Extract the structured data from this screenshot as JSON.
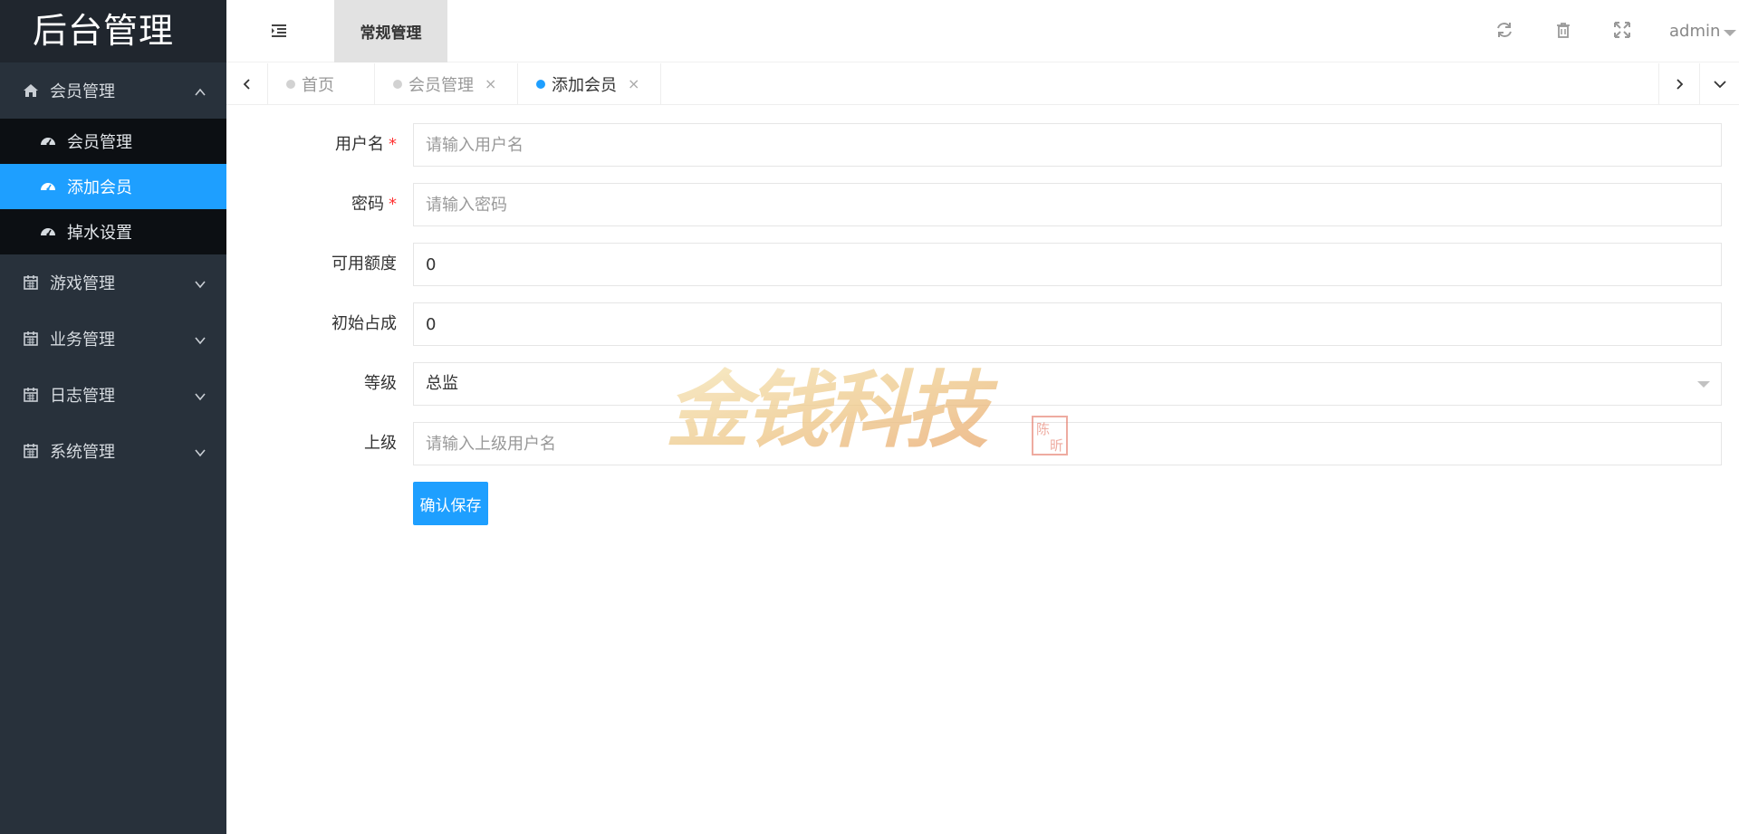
{
  "app": {
    "title": "后台管理"
  },
  "sidebar": {
    "groups": [
      {
        "label": "会员管理",
        "icon": "home-icon",
        "expanded": true,
        "items": [
          {
            "label": "会员管理",
            "icon": "dashboard-icon",
            "active": false
          },
          {
            "label": "添加会员",
            "icon": "dashboard-icon",
            "active": true
          },
          {
            "label": "掉水设置",
            "icon": "dashboard-icon",
            "active": false
          }
        ]
      },
      {
        "label": "游戏管理",
        "icon": "calendar-icon",
        "expanded": false
      },
      {
        "label": "业务管理",
        "icon": "calendar-icon",
        "expanded": false
      },
      {
        "label": "日志管理",
        "icon": "calendar-icon",
        "expanded": false
      },
      {
        "label": "系统管理",
        "icon": "calendar-icon",
        "expanded": false
      }
    ]
  },
  "topbar": {
    "menu_toggle_icon": "indent-icon",
    "active_top_tab": "常规管理",
    "tools": [
      "refresh-icon",
      "trash-icon",
      "fullscreen-icon"
    ],
    "user": "admin"
  },
  "tabs": {
    "items": [
      {
        "label": "首页",
        "closable": false,
        "active": false
      },
      {
        "label": "会员管理",
        "closable": true,
        "active": false
      },
      {
        "label": "添加会员",
        "closable": true,
        "active": true
      }
    ],
    "close_glyph": "×"
  },
  "form": {
    "username": {
      "label": "用户名",
      "required": "*",
      "placeholder": "请输入用户名",
      "value": ""
    },
    "password": {
      "label": "密码",
      "required": "*",
      "placeholder": "请输入密码",
      "value": ""
    },
    "credit": {
      "label": "可用额度",
      "value": "0"
    },
    "share": {
      "label": "初始占成",
      "value": "0"
    },
    "level": {
      "label": "等级",
      "value": "总监"
    },
    "parent": {
      "label": "上级",
      "placeholder": "请输入上级用户名",
      "value": ""
    },
    "save_label": "确认保存"
  },
  "watermark": {
    "text": "金钱科技",
    "seal": "陈昕"
  },
  "colors": {
    "sidebar_bg": "#28313b",
    "accent": "#1e9fff",
    "required": "#ff3333"
  }
}
